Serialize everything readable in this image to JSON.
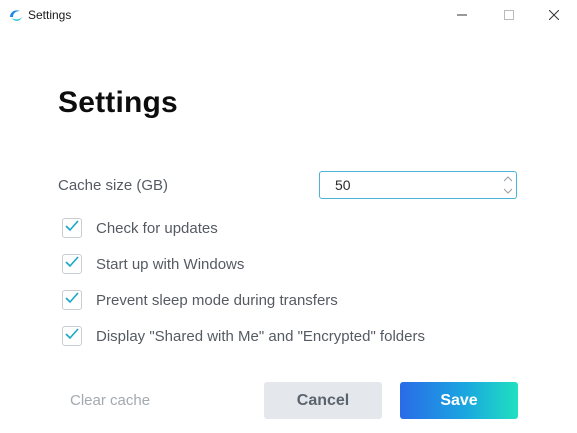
{
  "window": {
    "title": "Settings",
    "icon": "app-logo-icon",
    "controls": [
      "minimize-icon",
      "maximize-icon",
      "close-icon"
    ]
  },
  "page": {
    "title": "Settings"
  },
  "cache": {
    "label": "Cache size (GB)",
    "value": "50"
  },
  "options": [
    {
      "label": "Check for updates",
      "checked": true
    },
    {
      "label": "Start up with Windows",
      "checked": true
    },
    {
      "label": "Prevent sleep mode during transfers",
      "checked": true
    },
    {
      "label": "Display \"Shared with Me\" and \"Encrypted\" folders",
      "checked": true
    }
  ],
  "actions": {
    "clear_cache": "Clear cache",
    "cancel": "Cancel",
    "save": "Save"
  },
  "colors": {
    "check": "#1aa6c9",
    "save_gradient_start": "#2a6be8",
    "save_gradient_end": "#20e0c0",
    "input_border": "#4ab3d6"
  }
}
